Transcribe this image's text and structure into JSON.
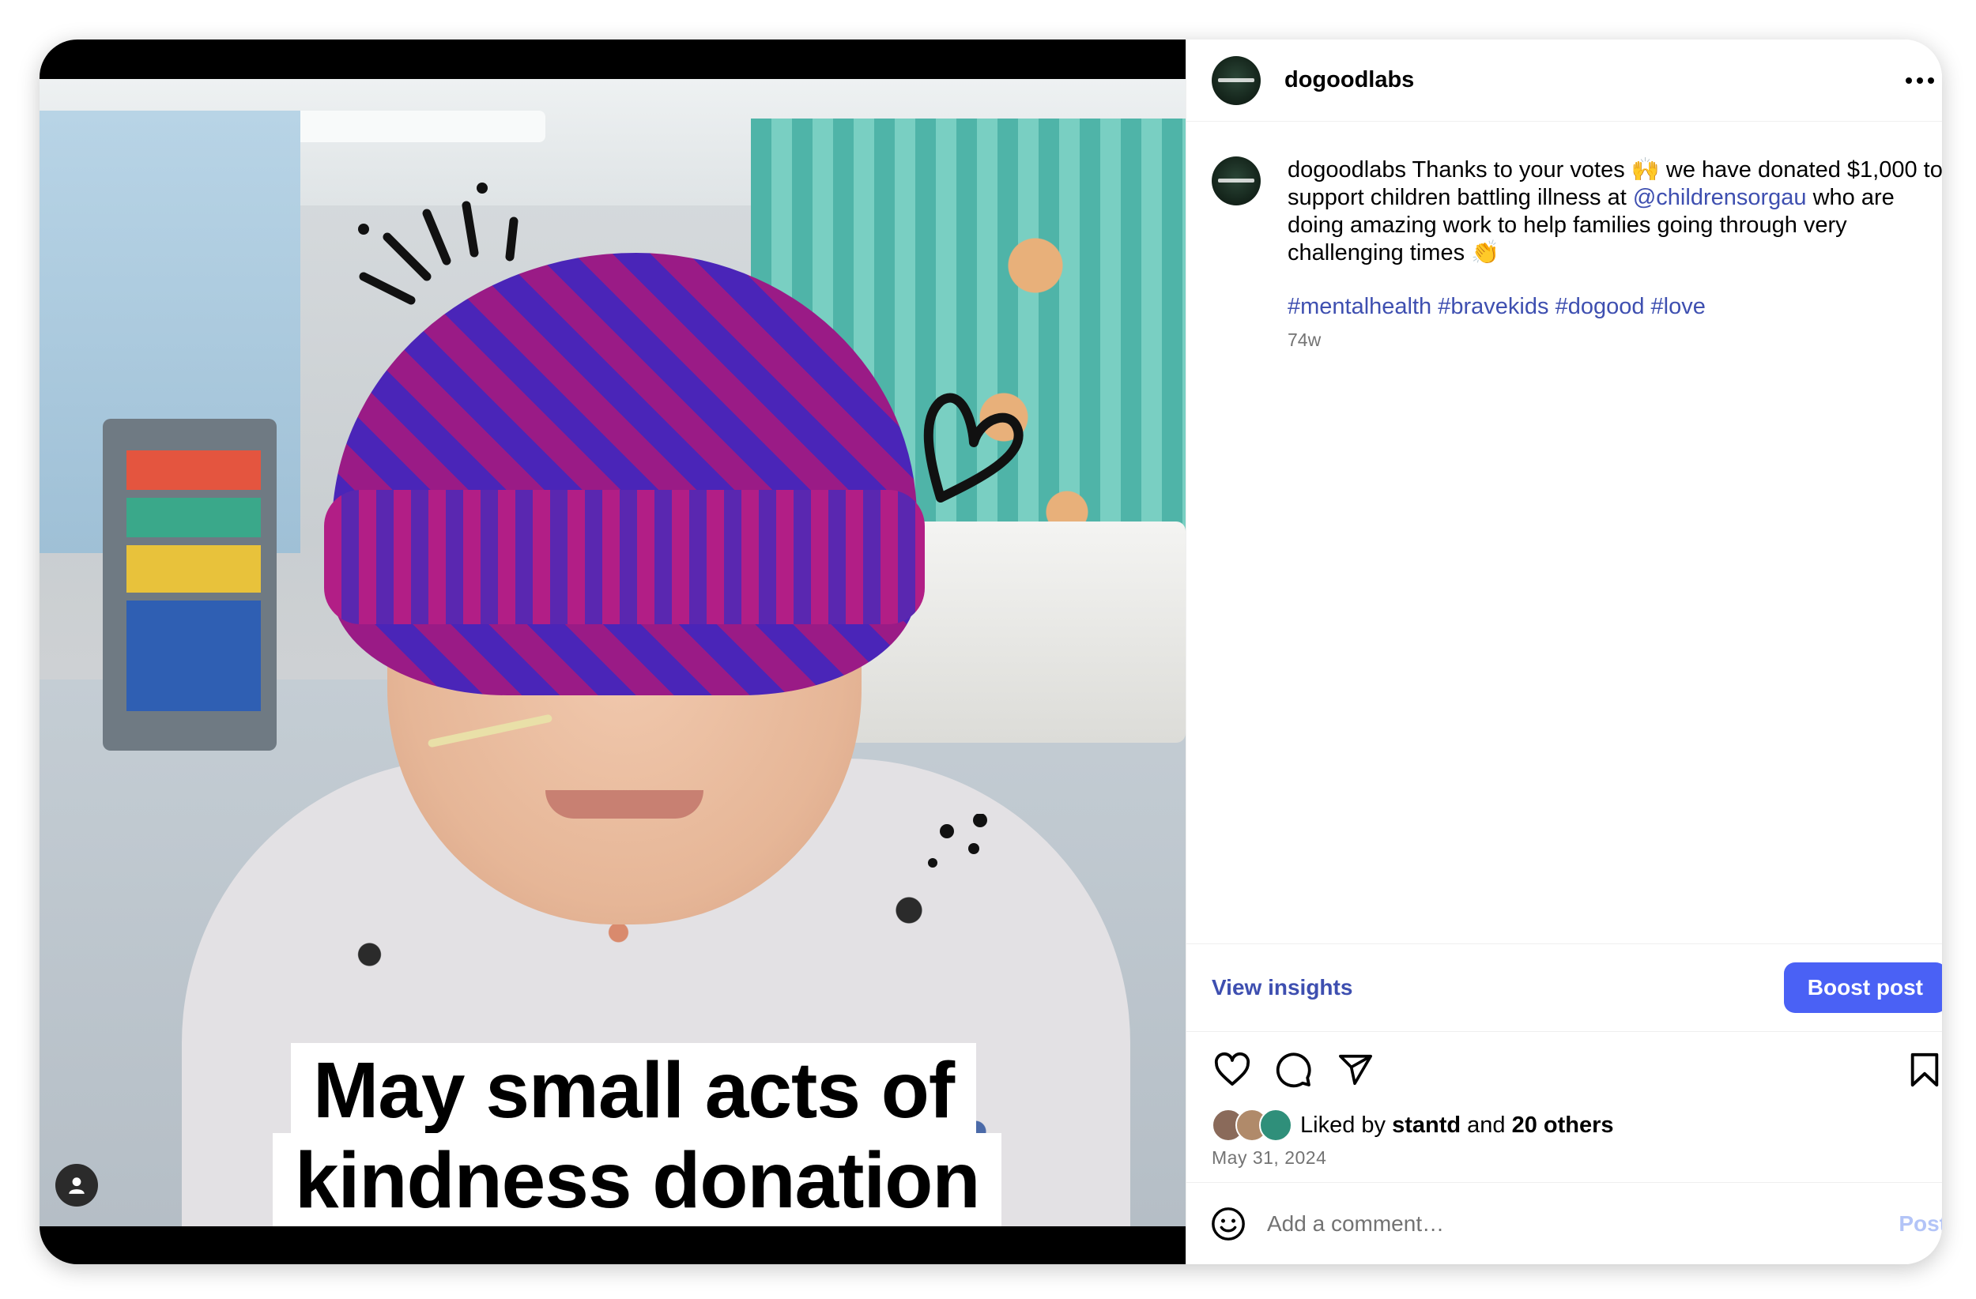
{
  "post": {
    "username": "dogoodlabs",
    "caption_user": "dogoodlabs",
    "caption_part1": " Thanks to your votes 🙌 we have donated $1,000 to support children battling illness at ",
    "mention": "@childrensorgau",
    "caption_part2": " who are doing amazing work to help families going through very challenging times 👏",
    "hashtags": [
      "#mentalhealth",
      "#bravekids",
      "#dogood",
      "#love"
    ],
    "age": "74w",
    "image_caption_line1": "May small acts of",
    "image_caption_line2": "kindness donation"
  },
  "insights": {
    "view_label": "View insights",
    "boost_label": "Boost post"
  },
  "likes": {
    "prefix": "Liked by ",
    "user": "stantd",
    "middle": " and ",
    "others": "20 others"
  },
  "date": "May 31, 2024",
  "comment": {
    "placeholder": "Add a comment…",
    "post_label": "Post"
  },
  "icons": {
    "more": "more-options-icon",
    "like": "heart-icon",
    "comment": "comment-icon",
    "share": "share-icon",
    "save": "bookmark-icon",
    "emoji": "emoji-icon",
    "tagged_user": "user-icon"
  },
  "colors": {
    "link": "#3e4fb0",
    "boost_button": "#4a61f5",
    "post_disabled": "#b3c4f7",
    "secondary_text": "#737373"
  }
}
